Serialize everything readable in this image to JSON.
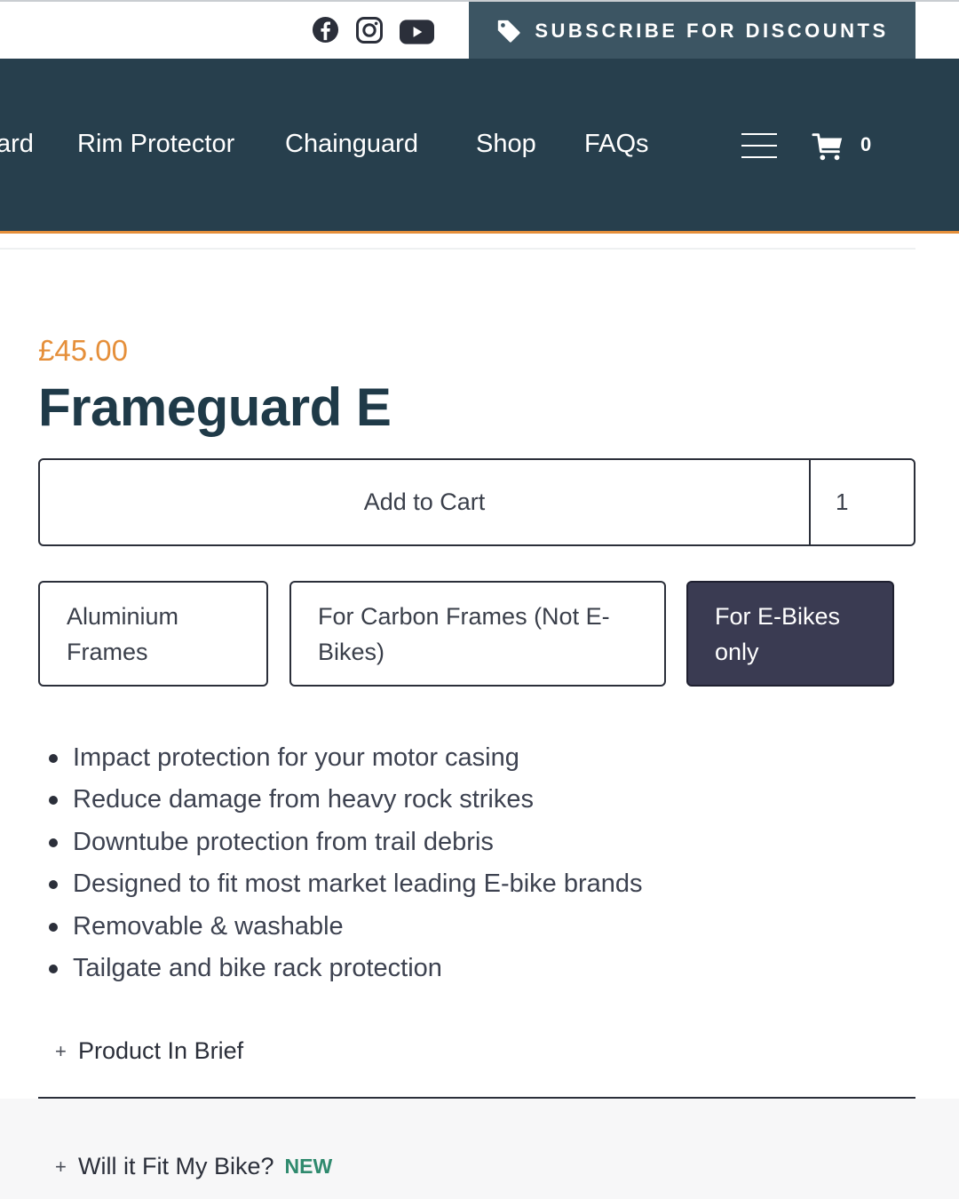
{
  "topbar": {
    "social": [
      "facebook-icon",
      "instagram-icon",
      "youtube-icon"
    ],
    "subscribe_label": "SUBSCRIBE FOR DISCOUNTS",
    "subscribe_icon": "tag-icon"
  },
  "nav": {
    "items": [
      {
        "label": "ard"
      },
      {
        "label": "Rim Protector"
      },
      {
        "label": "Chainguard"
      },
      {
        "label": "Shop"
      },
      {
        "label": "FAQs"
      }
    ],
    "menu_icon": "hamburger-icon",
    "cart_icon": "cart-icon",
    "cart_count": "0"
  },
  "product": {
    "price": "£45.00",
    "title": "Frameguard E",
    "add_to_cart_label": "Add to Cart",
    "quantity": "1",
    "options": [
      {
        "label": "Aluminium Frames",
        "selected": false
      },
      {
        "label": "For Carbon Frames (Not E-Bikes)",
        "selected": false
      },
      {
        "label": "For E-Bikes only",
        "selected": true
      }
    ],
    "features": [
      "Impact protection for your motor casing",
      "Reduce damage from heavy rock strikes",
      "Downtube protection from trail debris",
      "Designed to fit most market leading E-bike brands",
      "Removable & washable",
      "Tailgate and bike rack protection"
    ],
    "accordions": [
      {
        "plus": "+",
        "label": "Product In Brief",
        "badge": ""
      },
      {
        "plus": "+",
        "label": "Will it Fit My Bike?",
        "badge": "NEW"
      }
    ]
  },
  "colors": {
    "nav_bg": "#273f4d",
    "subscribe_bg": "#3c5563",
    "accent_orange": "#e58f3a",
    "title": "#1f3a48",
    "selected_option_bg": "#3a3b52",
    "new_badge": "#2f8a6e"
  }
}
